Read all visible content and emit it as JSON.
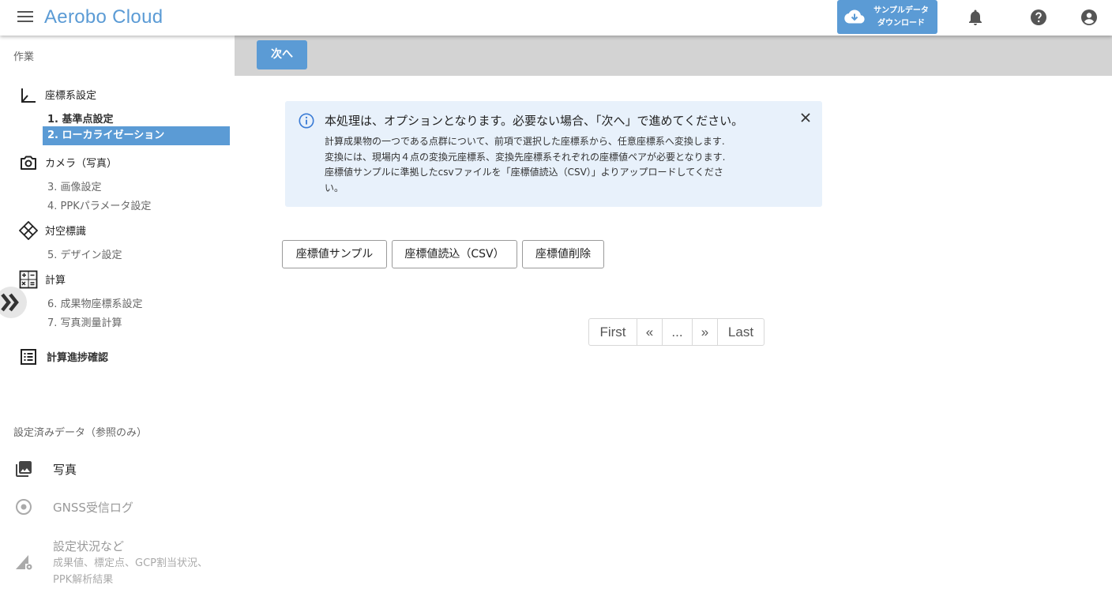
{
  "header": {
    "app_title": "Aerobo Cloud",
    "download_line1": "サンプルデータ",
    "download_line2": "ダウンロード"
  },
  "sidebar": {
    "section_work": "作業",
    "steps": [
      {
        "title": "座標系設定",
        "icon": "axis-icon",
        "items": [
          "1. 基準点設定",
          "2. ローカライゼーション"
        ]
      },
      {
        "title": "カメラ（写真）",
        "icon": "camera-icon",
        "items": [
          "3. 画像設定",
          "4. PPKパラメータ設定"
        ]
      },
      {
        "title": "対空標識",
        "icon": "target-marker-icon",
        "items": [
          "5. デザイン設定"
        ]
      },
      {
        "title": "計算",
        "icon": "calculator-icon",
        "items": [
          "6. 成果物座標系設定",
          "7. 写真測量計算"
        ]
      },
      {
        "title": "計算進捗確認",
        "icon": "list-icon",
        "items": []
      }
    ],
    "active_item": "2. ローカライゼーション",
    "section_ref": "設定済みデータ（参照のみ）",
    "ref_items": [
      {
        "label": "写真",
        "icon": "photo-library-icon"
      },
      {
        "label": "GNSS受信ログ",
        "icon": "radio-target-icon"
      },
      {
        "label": "設定状況など",
        "sub": "成果値、標定点、GCP割当状況、PPK解析結果",
        "icon": "settings-signal-icon"
      }
    ]
  },
  "main": {
    "next_label": "次へ",
    "info": {
      "title": "本処理は、オプションとなります。必要ない場合、「次へ」で進めてください。",
      "lines": [
        "計算成果物の一つである点群について、前項で選択した座標系から、任意座標系へ変換します.",
        "変換には、現場内４点の変換元座標系、変換先座標系それぞれの座標値ペアが必要となります.",
        "座標値サンプルに準拠したcsvファイルを「座標値読込（CSV）」よりアップロードしてくださ",
        "い。"
      ]
    },
    "buttons": {
      "sample": "座標値サンプル",
      "import": "座標値読込（CSV）",
      "delete": "座標値削除"
    },
    "pager": {
      "first": "First",
      "prev": "«",
      "ellipsis": "...",
      "next": "»",
      "last": "Last"
    }
  },
  "colors": {
    "accent": "#5b9bd5",
    "info_bg": "#e8f1fb",
    "topbar_bg": "#d3d3d3"
  }
}
